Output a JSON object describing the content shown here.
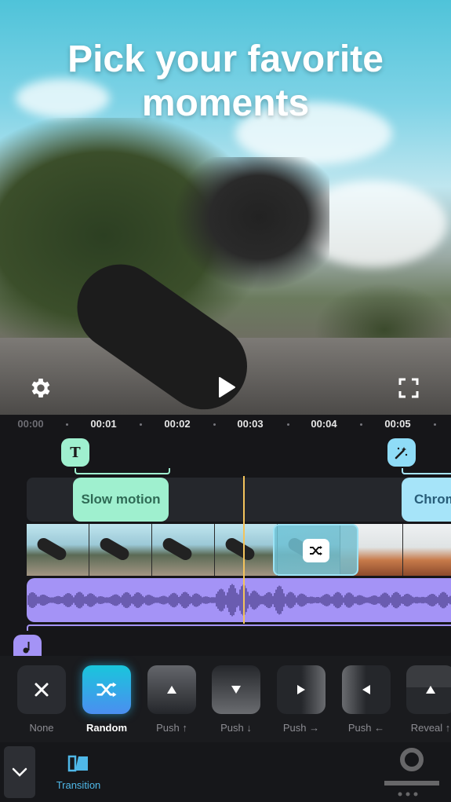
{
  "preview": {
    "headline_line1": "Pick your favorite",
    "headline_line2": "moments",
    "icons": [
      "settings-gear-icon",
      "play-icon",
      "fullscreen-icon"
    ]
  },
  "timeline": {
    "ruler": [
      "00:00",
      "00:01",
      "00:02",
      "00:03",
      "00:04",
      "00:05"
    ],
    "markers": {
      "text_marker_glyph": "T",
      "effect_marker_icon": "magic-wand-icon",
      "music_marker_icon": "music-note-icon"
    },
    "clips": {
      "slow_motion": "Slow motion",
      "chroma": "Chrom"
    },
    "transition_icon": "shuffle-icon"
  },
  "transitions": {
    "items": [
      {
        "label": "None",
        "icon": "close-icon",
        "selected": false
      },
      {
        "label": "Random",
        "icon": "shuffle-icon",
        "selected": true
      },
      {
        "label": "Push ↑",
        "icon": "triangle-up-icon",
        "selected": false
      },
      {
        "label": "Push ↓",
        "icon": "triangle-down-icon",
        "selected": false
      },
      {
        "label": "Push →",
        "icon": "triangle-right-icon",
        "selected": false
      },
      {
        "label": "Push ←",
        "icon": "triangle-left-icon",
        "selected": false
      },
      {
        "label": "Reveal ↑",
        "icon": "triangle-up-icon",
        "selected": false
      }
    ]
  },
  "bottombar": {
    "tab_label": "Transition",
    "collapse_icon": "chevron-down-icon"
  },
  "colors": {
    "accent_cyan": "#19c6dc",
    "text_clip": "#9ff0cf",
    "effect_clip": "#a6e4f9",
    "audio_track": "#a493f6",
    "playhead": "#f3c35c"
  }
}
